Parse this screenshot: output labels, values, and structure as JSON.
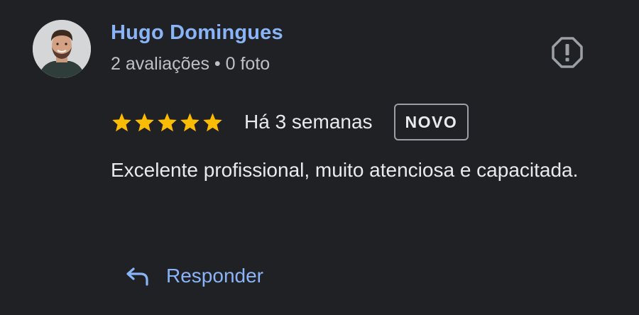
{
  "reviewer": {
    "name": "Hugo Domingues",
    "meta": "2 avaliações • 0 foto"
  },
  "review": {
    "rating": 5,
    "max_rating": 5,
    "time": "Há 3 semanas",
    "badge": "NOVO",
    "text": "Excelente profissional, muito atenciosa e capacitada."
  },
  "actions": {
    "reply_label": "Responder"
  },
  "icons": {
    "report": "report-icon",
    "reply": "reply-icon",
    "star": "star-icon"
  },
  "colors": {
    "background": "#202124",
    "link": "#8ab4f8",
    "star": "#fbbc04",
    "text": "#e8eaed",
    "secondary_text": "#bdc1c6"
  }
}
